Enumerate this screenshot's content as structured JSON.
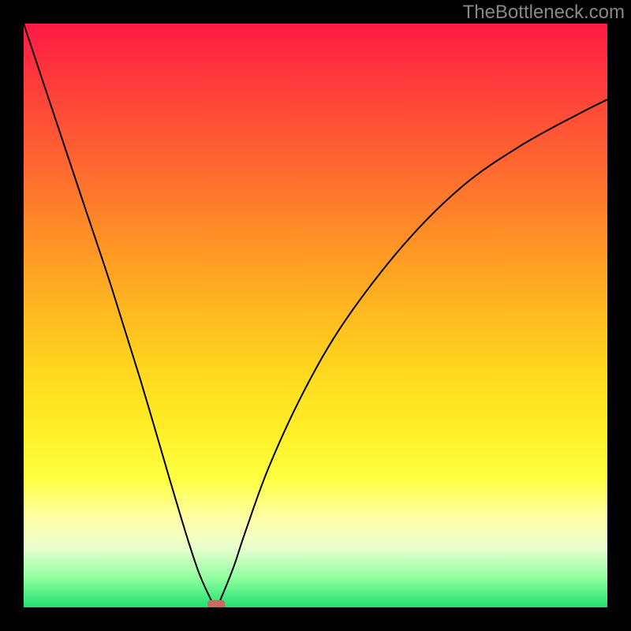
{
  "watermark": "TheBottleneck.com",
  "chart_data": {
    "type": "line",
    "title": "",
    "xlabel": "",
    "ylabel": "",
    "xlim": [
      0,
      100
    ],
    "ylim": [
      0,
      100
    ],
    "vertex_x": 33,
    "curve_style": "v-shaped asymmetric well with steep left branch and logarithmic right branch",
    "series": [
      {
        "name": "curve",
        "x": [
          0,
          5,
          10,
          15,
          20,
          25,
          28,
          30,
          32,
          33,
          34,
          36,
          38,
          42,
          48,
          55,
          65,
          75,
          85,
          95,
          100
        ],
        "values": [
          100,
          85,
          70,
          55,
          39,
          22,
          12,
          6,
          1.5,
          0,
          2,
          7,
          13,
          24,
          37,
          49,
          62,
          72,
          79,
          84.5,
          87
        ]
      }
    ],
    "annotations": [
      {
        "type": "marker",
        "x": 33,
        "y": 0.5,
        "shape": "rounded-rect",
        "color": "#c96a5f"
      }
    ],
    "background_gradient": {
      "direction": "vertical",
      "stops": [
        {
          "pos": 0.0,
          "color": "#ff1a44"
        },
        {
          "pos": 0.5,
          "color": "#ffbb1f"
        },
        {
          "pos": 0.78,
          "color": "#ffff44"
        },
        {
          "pos": 1.0,
          "color": "#20e070"
        }
      ]
    }
  }
}
